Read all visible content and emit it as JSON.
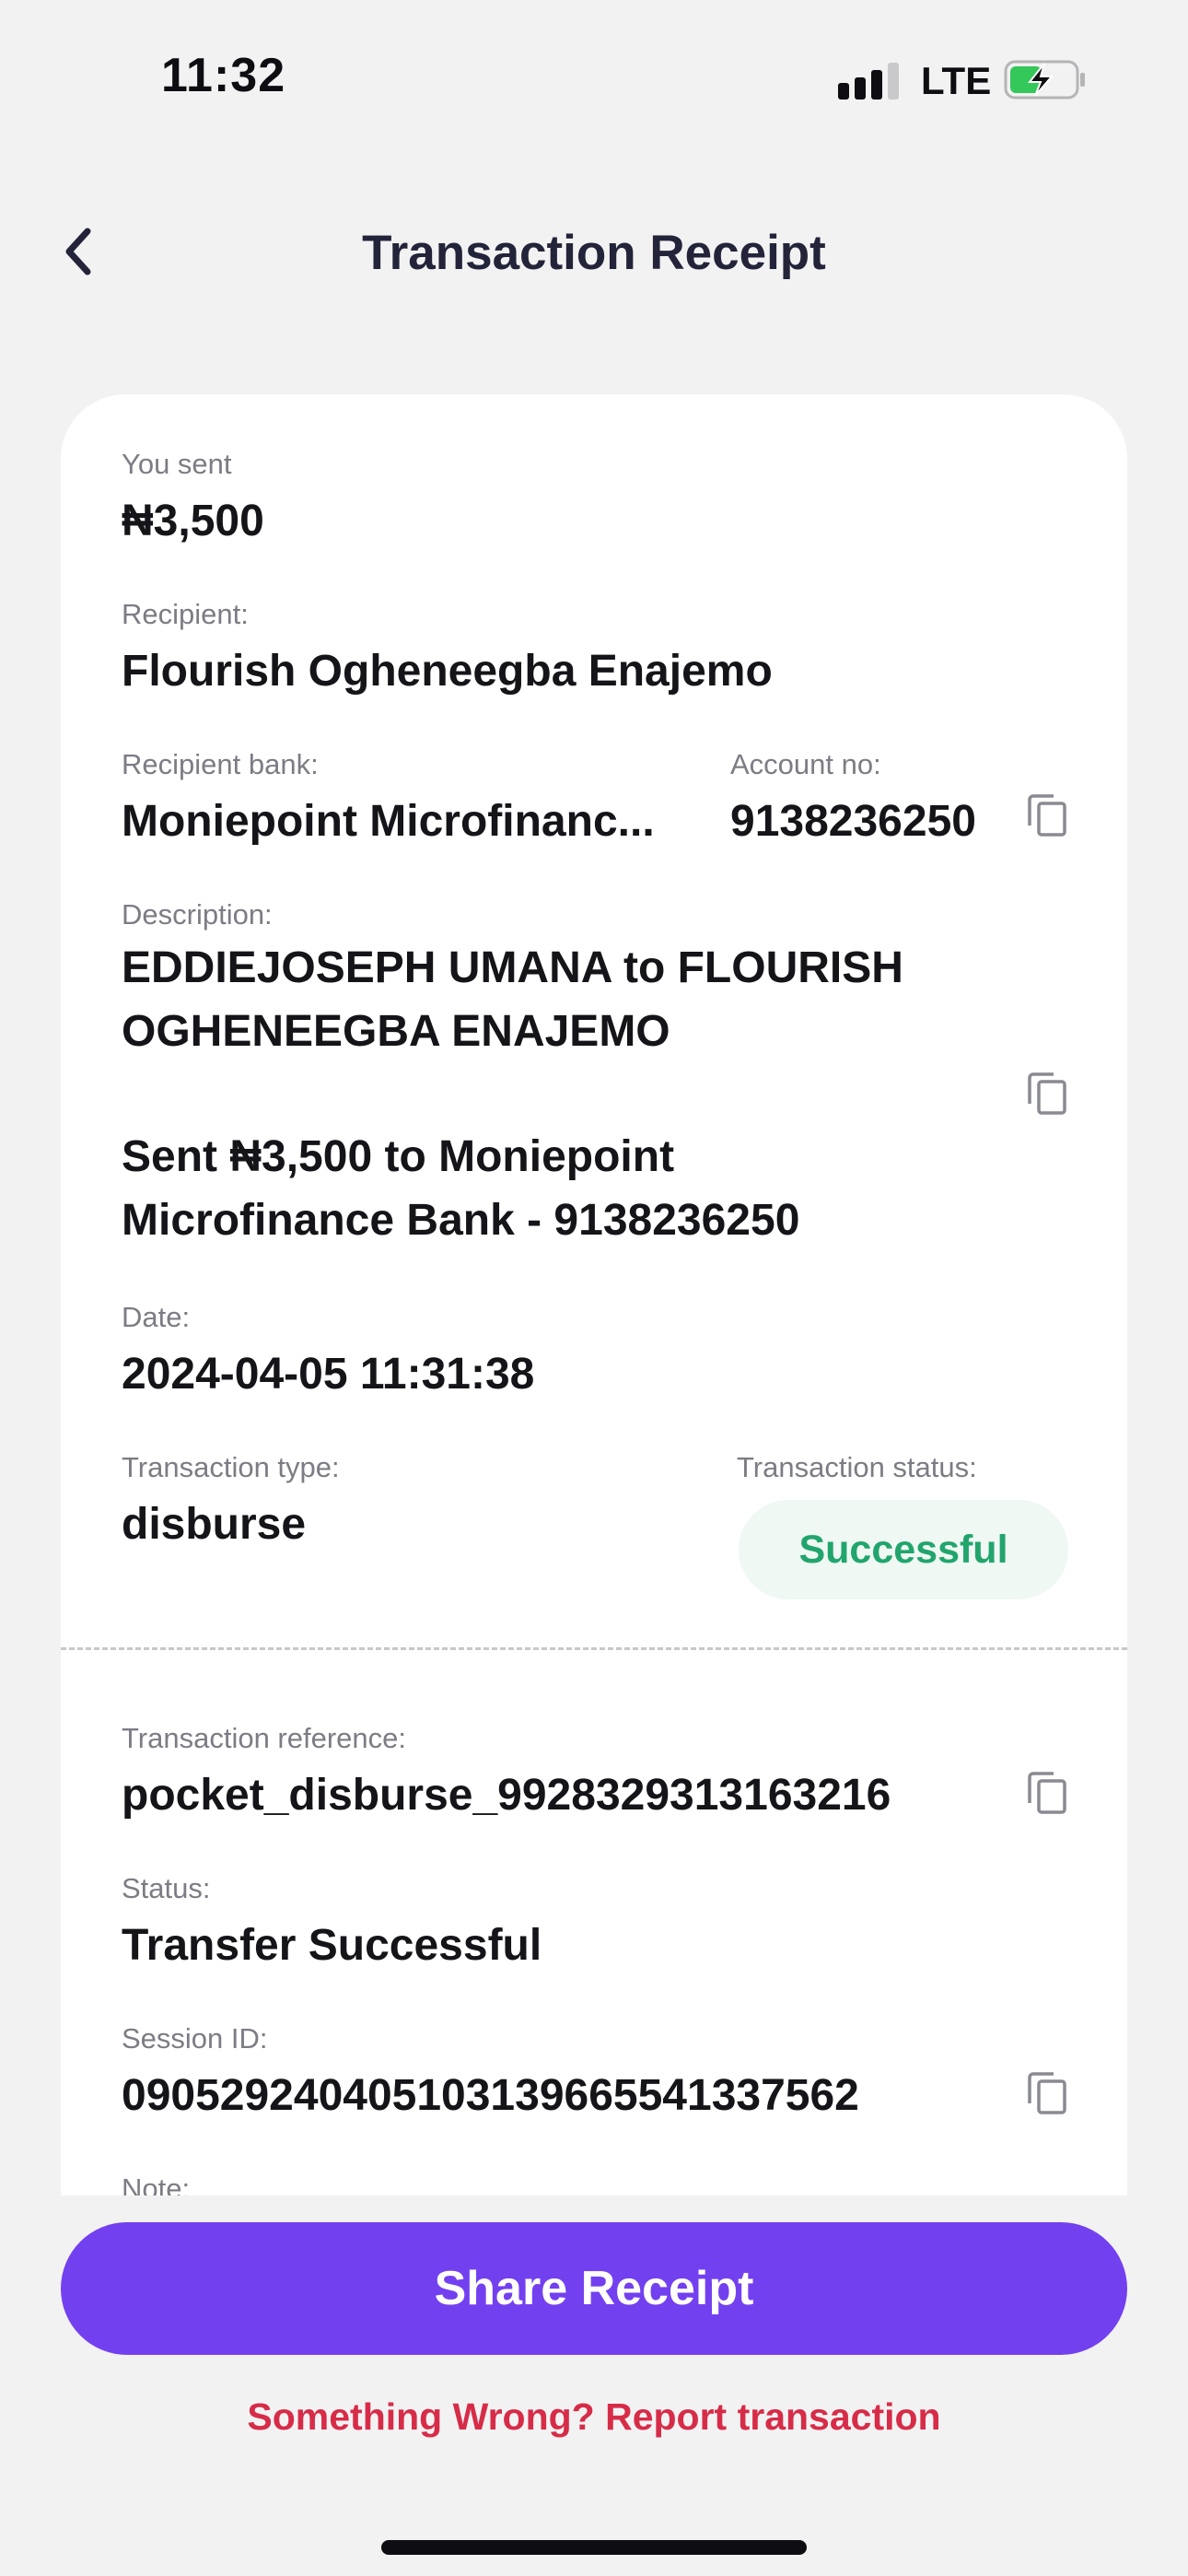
{
  "status_bar": {
    "time": "11:32",
    "network": "LTE"
  },
  "header": {
    "title": "Transaction Receipt"
  },
  "receipt": {
    "amount_label": "You sent",
    "amount": "₦3,500",
    "recipient_label": "Recipient:",
    "recipient": "Flourish Ogheneegba Enajemo",
    "bank_label": "Recipient bank:",
    "bank": "Moniepoint Microfinanc...",
    "account_label": "Account no:",
    "account": "9138236250",
    "description_label": "Description:",
    "description_line1": "EDDIEJOSEPH UMANA to FLOURISH",
    "description_line2": "OGHENEEGBA ENAJEMO",
    "description_line3": "Sent ₦3,500 to Moniepoint",
    "description_line4": "Microfinance Bank - 9138236250",
    "date_label": "Date:",
    "date": "2024-04-05 11:31:38",
    "type_label": "Transaction type:",
    "type": "disburse",
    "txn_status_label": "Transaction status:",
    "txn_status": "Successful",
    "reference_label": "Transaction reference:",
    "reference": "pocket_disburse_9928329313163216",
    "status_label": "Status:",
    "status": "Transfer Successful",
    "session_label": "Session ID:",
    "session": "090529240405103139665541337562",
    "note_label": "Note:"
  },
  "actions": {
    "share_label": "Share Receipt",
    "report_label": "Something Wrong? Report transaction"
  },
  "colors": {
    "primary": "#7340f0",
    "success": "#21a56c",
    "danger": "#d72c48"
  },
  "icons": [
    "back-arrow-icon",
    "copy-icon",
    "signal-icon",
    "battery-charging-icon"
  ]
}
